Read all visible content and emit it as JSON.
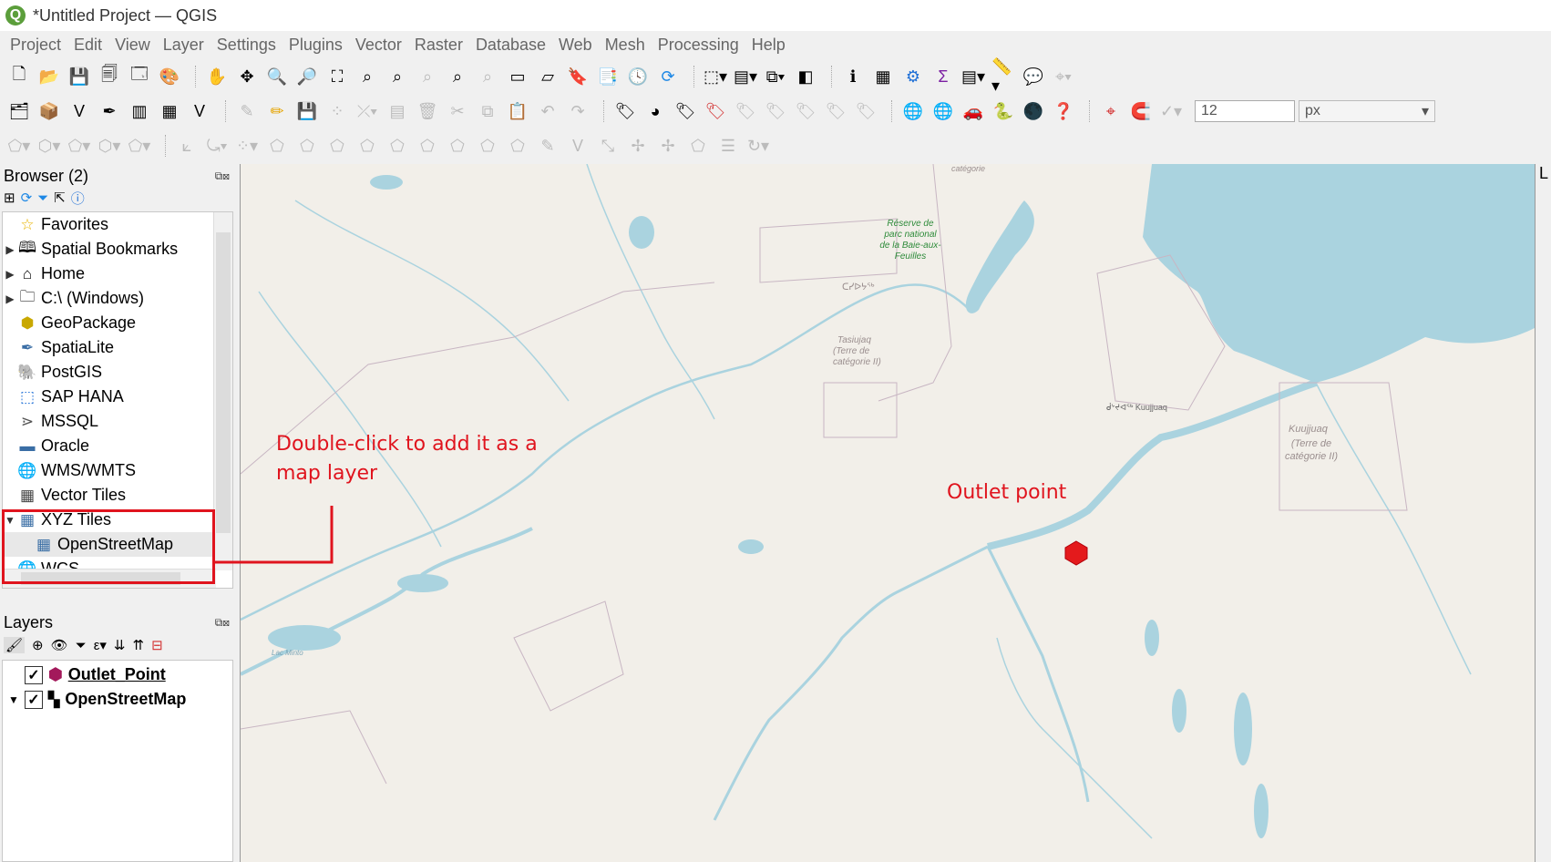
{
  "window": {
    "title": "*Untitled Project — QGIS"
  },
  "menu": [
    "Project",
    "Edit",
    "View",
    "Layer",
    "Settings",
    "Plugins",
    "Vector",
    "Raster",
    "Database",
    "Web",
    "Mesh",
    "Processing",
    "Help"
  ],
  "toolbar": {
    "symbol_size": "12",
    "unit": "px"
  },
  "browser": {
    "title": "Browser (2)",
    "items": [
      {
        "label": "Favorites",
        "icon": "star-icon",
        "arrow": ""
      },
      {
        "label": "Spatial Bookmarks",
        "icon": "bookmark-icon",
        "arrow": "▶"
      },
      {
        "label": "Home",
        "icon": "home-folder-icon",
        "arrow": "▶"
      },
      {
        "label": "C:\\ (Windows)",
        "icon": "drive-folder-icon",
        "arrow": "▶"
      },
      {
        "label": "GeoPackage",
        "icon": "geopackage-icon",
        "arrow": ""
      },
      {
        "label": "SpatiaLite",
        "icon": "spatialite-icon",
        "arrow": ""
      },
      {
        "label": "PostGIS",
        "icon": "postgis-icon",
        "arrow": ""
      },
      {
        "label": "SAP HANA",
        "icon": "sap-hana-icon",
        "arrow": ""
      },
      {
        "label": "MSSQL",
        "icon": "mssql-icon",
        "arrow": ""
      },
      {
        "label": "Oracle",
        "icon": "oracle-icon",
        "arrow": ""
      },
      {
        "label": "WMS/WMTS",
        "icon": "wms-globe-icon",
        "arrow": ""
      },
      {
        "label": "Vector Tiles",
        "icon": "vector-tiles-icon",
        "arrow": ""
      },
      {
        "label": "XYZ Tiles",
        "icon": "xyz-tiles-icon",
        "arrow": "▼"
      },
      {
        "label": "OpenStreetMap",
        "icon": "xyz-tiles-icon",
        "arrow": ""
      },
      {
        "label": "WCS",
        "icon": "wcs-globe-icon",
        "arrow": ""
      }
    ]
  },
  "layers": {
    "title": "Layers",
    "items": [
      {
        "label": "Outlet_Point",
        "checked": "✓",
        "arrow": ""
      },
      {
        "label": "OpenStreetMap",
        "checked": "✓",
        "arrow": "▼"
      }
    ]
  },
  "map": {
    "labels": {
      "reserve": "Réserve de parc national de la Baie-aux-Feuilles",
      "tasiujaq_syll": "ᑕᓯᐅᔭᖅ",
      "tasiujaq_cat": "(Terre de catégorie II)",
      "tasiujaq": "Tasiujaq",
      "kuujjuaq_syll": "ᑰᔾᔪᐊᖅ Kuujjuaq",
      "kuujjuaq_block": "(Terre de catégorie II)",
      "kuujjuaq": "Kuujjuaq",
      "lac_minto": "Lac Minto",
      "categorie": "catégorie"
    }
  },
  "annotations": {
    "double_click_line1": "Double-click to add it as a",
    "double_click_line2": "map layer",
    "outlet": "Outlet point"
  },
  "right_panel": {
    "label": "L"
  },
  "colors": {
    "annotation": "#e0141e",
    "water": "#aad3df",
    "land": "#f2efe9",
    "outlet": "#e41a1c"
  }
}
